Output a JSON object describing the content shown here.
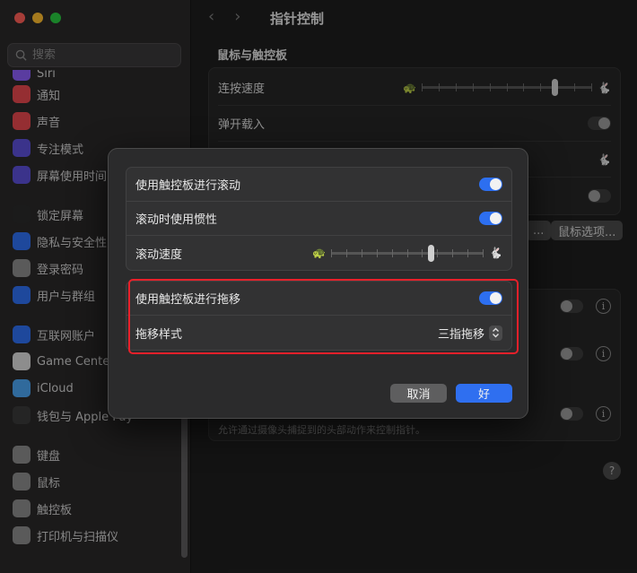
{
  "sidebar": {
    "search_placeholder": "搜索",
    "items": [
      {
        "label": "Siri",
        "icon": "siri-icon",
        "color": "#8b5cf6"
      },
      {
        "label": "通知",
        "icon": "bell-icon",
        "color": "#e5484d"
      },
      {
        "label": "声音",
        "icon": "speaker-icon",
        "color": "#e5484d"
      },
      {
        "label": "专注模式",
        "icon": "moon-icon",
        "color": "#5b4fd6"
      },
      {
        "label": "屏幕使用时间",
        "icon": "hourglass-icon",
        "color": "#5b4fd6"
      },
      {
        "label": "锁定屏幕",
        "icon": "lock-icon",
        "color": "#2a2a2a"
      },
      {
        "label": "隐私与安全性",
        "icon": "hand-icon",
        "color": "#2f6ff0"
      },
      {
        "label": "登录密码",
        "icon": "key-icon",
        "color": "#8a8a8a"
      },
      {
        "label": "用户与群组",
        "icon": "users-icon",
        "color": "#2f6ff0"
      },
      {
        "label": "互联网账户",
        "icon": "at-icon",
        "color": "#2f6ff0"
      },
      {
        "label": "Game Center",
        "icon": "game-center-icon",
        "color": "#d9d9d9"
      },
      {
        "label": "iCloud",
        "icon": "cloud-icon",
        "color": "#4aa3f0"
      },
      {
        "label": "钱包与 Apple Pay",
        "icon": "wallet-icon",
        "color": "#3a3a3a"
      },
      {
        "label": "键盘",
        "icon": "keyboard-icon",
        "color": "#8a8a8a"
      },
      {
        "label": "鼠标",
        "icon": "mouse-icon",
        "color": "#8a8a8a"
      },
      {
        "label": "触控板",
        "icon": "trackpad-icon",
        "color": "#8a8a8a"
      },
      {
        "label": "打印机与扫描仪",
        "icon": "printer-icon",
        "color": "#8a8a8a"
      }
    ]
  },
  "main": {
    "title": "指针控制",
    "section": "鼠标与触控板",
    "rows": {
      "double_click_speed": "连按速度",
      "spring_loading": "弹开载入"
    },
    "button_partial": "...",
    "mouse_options": "鼠标选项...",
    "footer_note": "允许通过摄像头捕捉到的头部动作来控制指针。",
    "help": "?"
  },
  "dialog": {
    "scroll_label": "使用触控板进行滚动",
    "inertia_label": "滚动时使用惯性",
    "speed_label": "滚动速度",
    "speed_level": 0.65,
    "drag_label": "使用触控板进行拖移",
    "drag_style_label": "拖移样式",
    "drag_style_value": "三指拖移",
    "cancel": "取消",
    "ok": "好"
  },
  "colors": {
    "accent": "#2f6ff0",
    "highlight": "#e8202a"
  }
}
